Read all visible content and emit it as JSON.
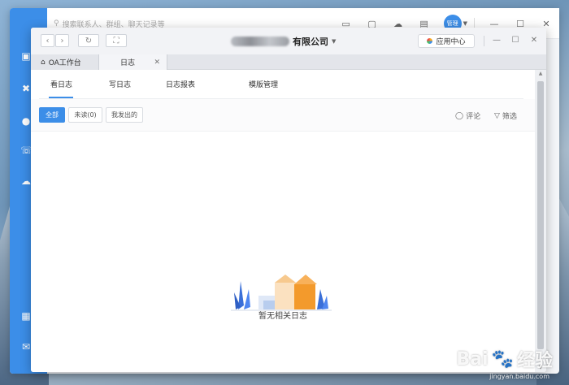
{
  "background_window": {
    "search_placeholder": "搜索联系人、群组、聊天记录等",
    "avatar_label": "管理"
  },
  "window": {
    "company_name": "有限公司",
    "app_center": "应用中心"
  },
  "tabs": [
    {
      "label": "OA工作台"
    },
    {
      "label": "日志"
    }
  ],
  "subnav": [
    {
      "label": "看日志",
      "active": true
    },
    {
      "label": "写日志"
    },
    {
      "label": "日志报表"
    },
    {
      "label": "模版管理"
    }
  ],
  "filters": [
    {
      "label": "全部",
      "active": true
    },
    {
      "label": "未读(0)"
    },
    {
      "label": "我发出的"
    }
  ],
  "tools": {
    "comment": "评论",
    "filter": "筛选"
  },
  "empty_state": {
    "message": "暂无相关日志"
  },
  "watermark": {
    "brand": "Bai",
    "brand2": "经验",
    "url": "jingyan.baidu.com"
  },
  "colors": {
    "accent": "#3c8ee8",
    "sidebar": "#3c8ee8"
  }
}
